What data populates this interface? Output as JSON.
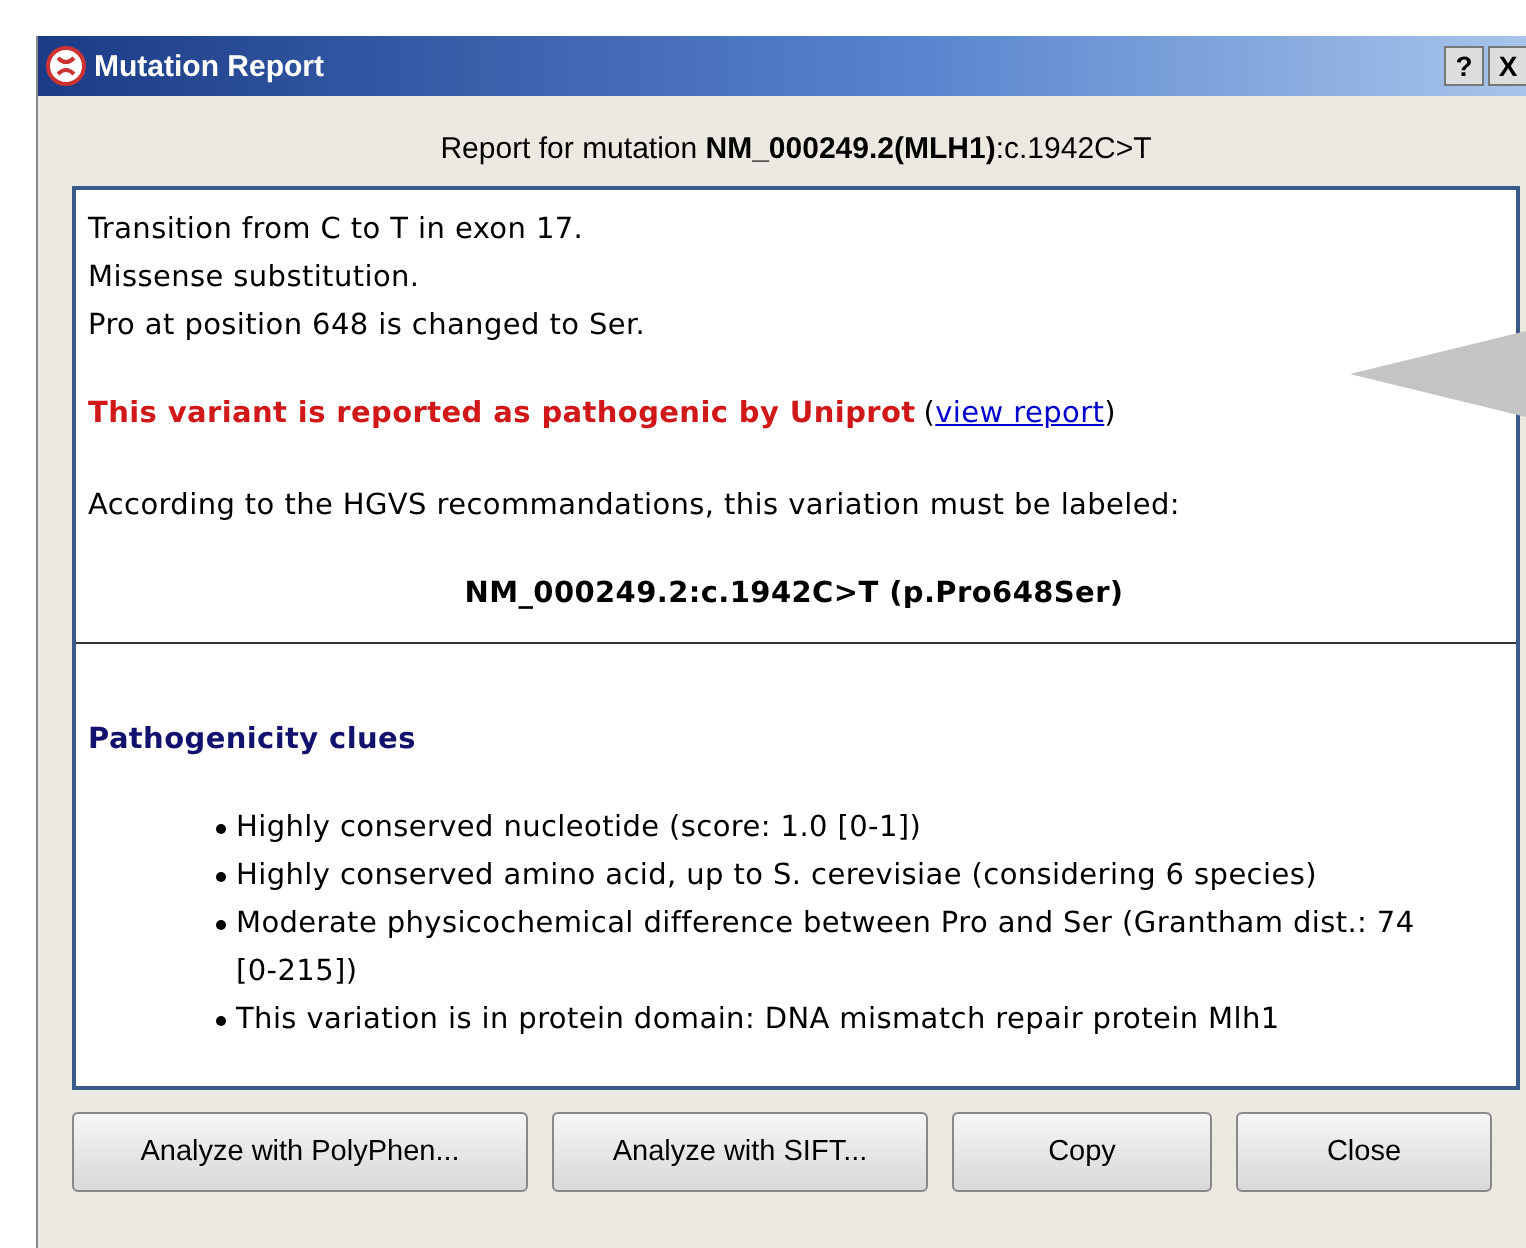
{
  "window": {
    "title": "Mutation Report",
    "help": "?",
    "close": "X"
  },
  "header": "Report for mutation **NM_000249.2(MLH1)**:c.1942C>T",
  "report": {
    "lines": [
      "Transition from C to T in exon 17.",
      "Missense substitution.",
      "Pro at position 648 is changed to Ser."
    ],
    "warning": "This variant is reported as pathogenic by Uniprot",
    "link_prefix": "(",
    "link": "view report",
    "link_suffix": ")",
    "hgvs_note": "According to the HGVS recommandations, this variation must be labeled:",
    "hgvs_label": "NM_000249.2:c.1942C>T (p.Pro648Ser)",
    "clues_title": "Pathogenicity clues",
    "clues": [
      "Highly conserved nucleotide (score: 1.0 [0-1])",
      "Highly conserved amino acid, up to S. cerevisiae (considering 6 species)",
      "Moderate physicochemical difference between Pro and Ser (Grantham dist.: 74 [0-215])",
      "This variation is in protein domain: DNA mismatch repair protein Mlh1"
    ]
  },
  "buttons": [
    "Analyze with PolyPhen...",
    "Analyze with SIFT...",
    "Copy",
    "Close"
  ]
}
